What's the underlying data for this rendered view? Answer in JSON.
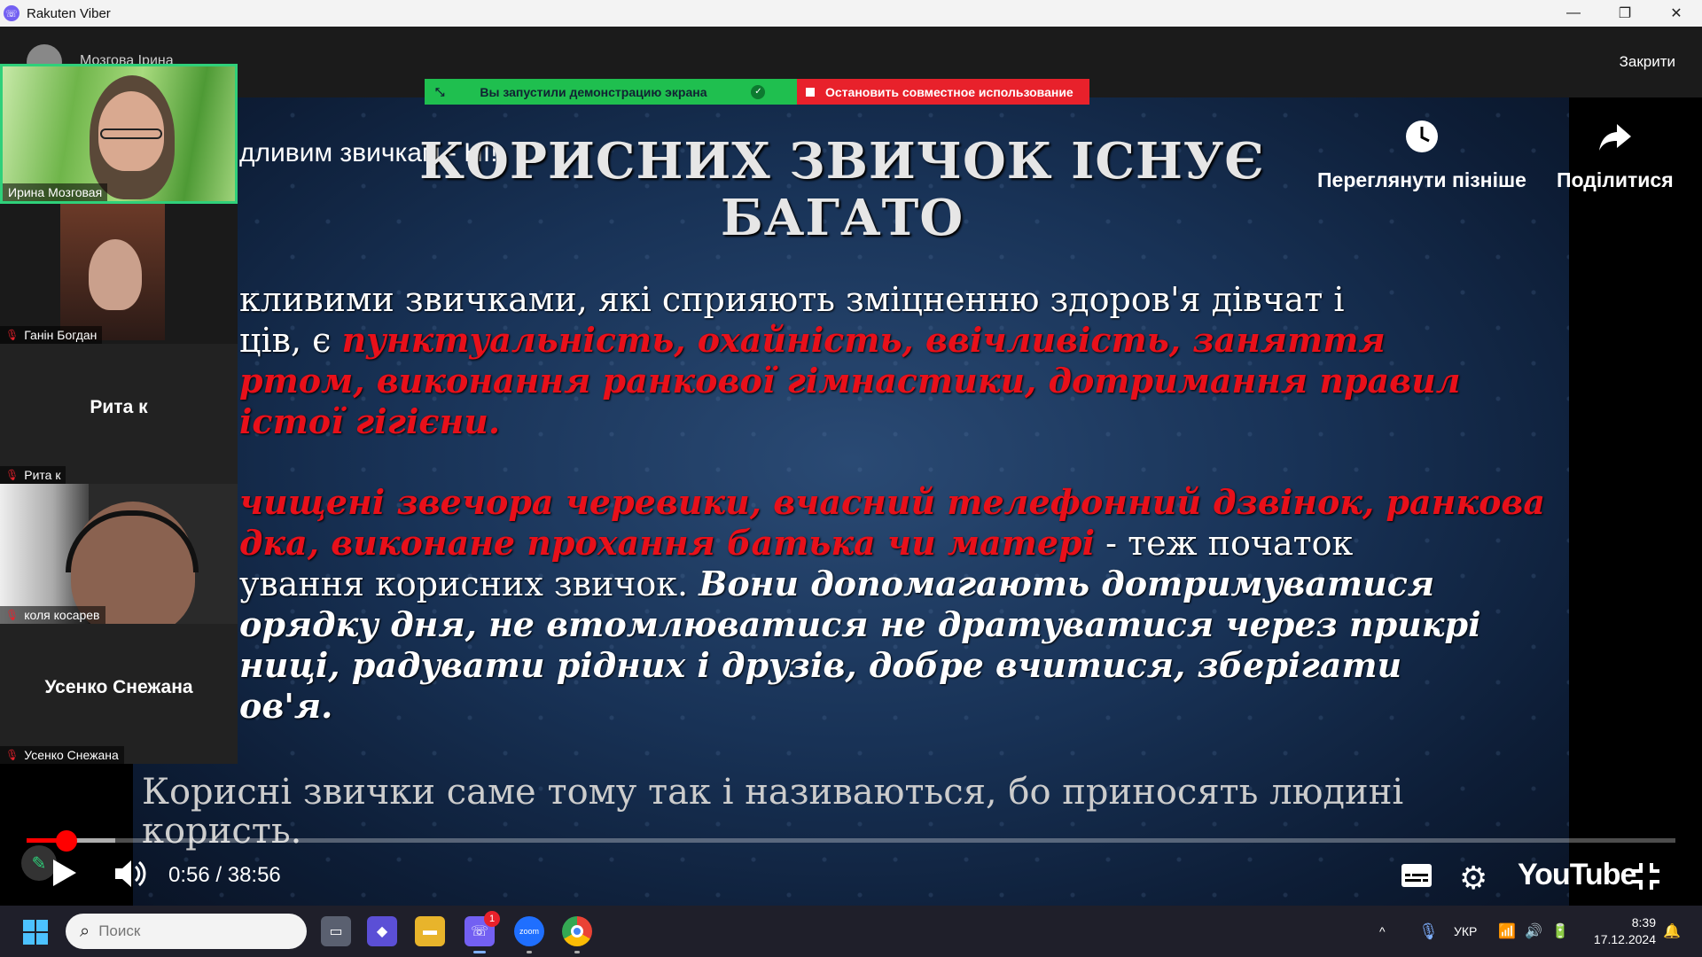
{
  "window": {
    "title": "Rakuten Viber",
    "minimize": "—",
    "restore": "❐",
    "close": "✕"
  },
  "header": {
    "name": "Мозгова Ірина",
    "close_label": "Закрити"
  },
  "share_banner": {
    "green_text": "Вы запустили демонстрацию экрана",
    "red_text": "Остановить совместное использование"
  },
  "video": {
    "caption_fragment": "дливим звичкам - НІ!",
    "slide_title_line1": "КОРИСНИХ ЗВИЧОК ІСНУЄ",
    "slide_title_line2": "БАГАТО",
    "para1_lines": [
      {
        "plain": "кливими звичками, які сприяють зміцненню здоров'я дівчат і",
        "red": ""
      },
      {
        "plain": "ців, є ",
        "red": "пунктуальність, охайність, ввічливість, заняття"
      },
      {
        "plain": "",
        "red": "ртом, виконання ранкової гімнастики, дотримання правил"
      },
      {
        "plain": "",
        "red": "істої гігієни."
      }
    ],
    "para2_line1_red": "чищені звечора черевики, вчасний телефонний дзвінок, ранкова",
    "para2_line2_red": "дка, виконане прохання батька чи матері",
    "para2_line2_plain": " - теж початок",
    "para2_line3_plain": "ування корисних звичок. ",
    "para2_line3_bi": "Вони допомагають дотримуватися",
    "para2_line4_bi": "орядку дня, не втомлюватися не дратуватися через прикрі",
    "para2_line5_bi": "ниці, радувати рідних і друзів, добре вчитися, зберігати",
    "para2_line6_bi": "ов'я.",
    "footer_line1": "Корисні звички саме тому так і називаються, бо приносять людині",
    "footer_line2": "користь."
  },
  "youtube": {
    "watch_later": "Переглянути пізніше",
    "share": "Поділитися",
    "time": "0:56 / 38:56",
    "logo": "YouTube",
    "progress_fraction": 0.024
  },
  "participants": [
    {
      "name": "Ирина Мозговая",
      "type": "video-grass",
      "active": true
    },
    {
      "name": "Ганін Богдан",
      "type": "video-cam",
      "active": false
    },
    {
      "name": "Рита к",
      "center": "Рита к",
      "type": "no-video",
      "active": false
    },
    {
      "name": "коля косарев",
      "type": "video-window",
      "active": false
    },
    {
      "name": "Усенко Снежана",
      "center": "Усенко Снежана",
      "type": "no-video",
      "active": false
    }
  ],
  "taskbar": {
    "search_placeholder": "Поиск",
    "viber_badge": "1",
    "zoom_label": "zoom",
    "language": "УКР",
    "time": "8:39",
    "date": "17.12.2024"
  },
  "colors": {
    "accent_green": "#2fd07a",
    "share_red": "#e8212b",
    "slide_red": "#e8101a",
    "viber": "#7360f2"
  }
}
